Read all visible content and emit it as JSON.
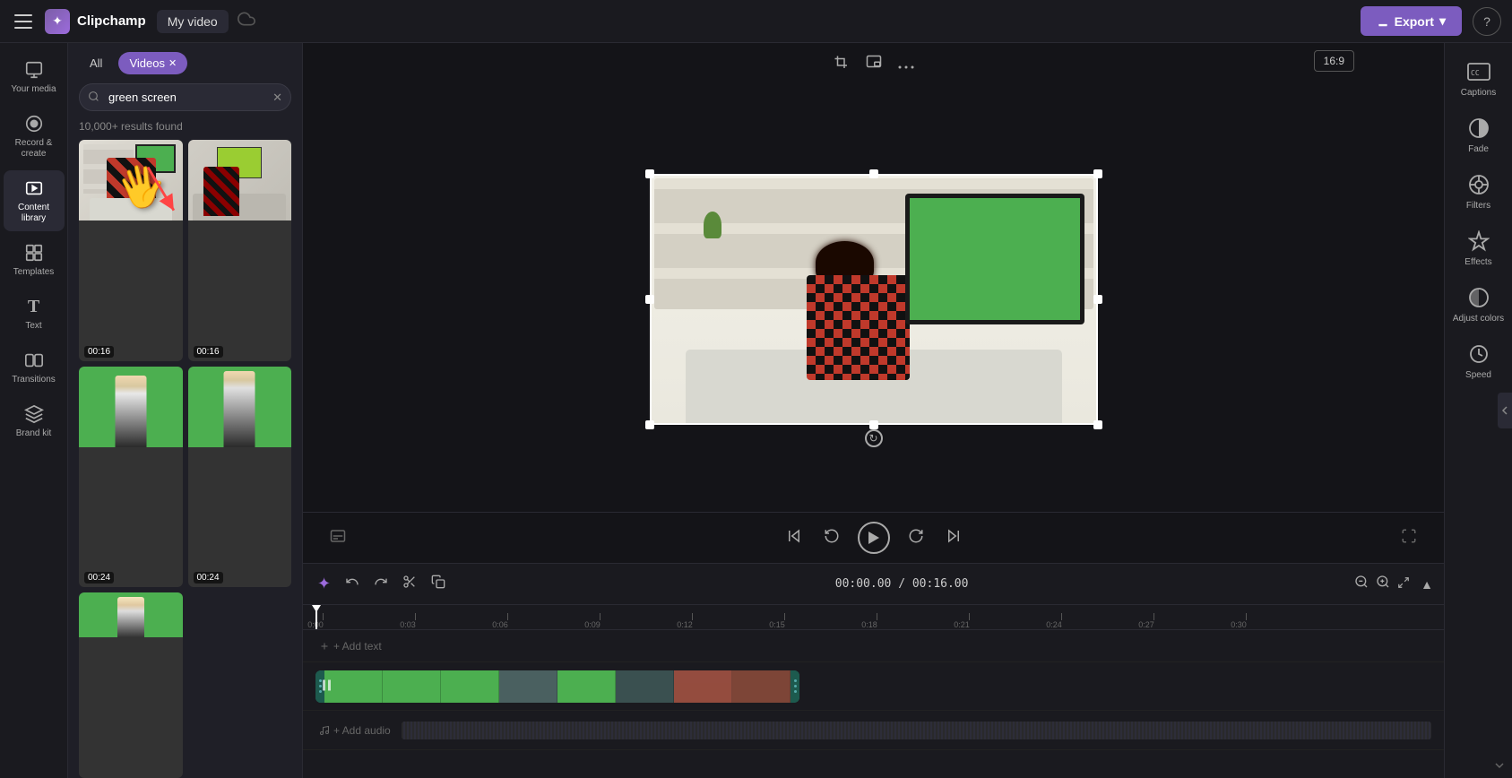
{
  "topbar": {
    "menu_label": "Menu",
    "logo_text": "Clipchamp",
    "logo_icon": "✦",
    "project_name": "My video",
    "cloud_icon": "☁",
    "export_label": "Export",
    "help_icon": "?"
  },
  "sidebar": {
    "items": [
      {
        "id": "your-media",
        "label": "Your media",
        "icon": "🖼"
      },
      {
        "id": "record-create",
        "label": "Record &\ncreate",
        "icon": "⏺"
      },
      {
        "id": "content-library",
        "label": "Content library",
        "icon": "📚"
      },
      {
        "id": "templates",
        "label": "Templates",
        "icon": "⊞"
      },
      {
        "id": "text",
        "label": "Text",
        "icon": "T"
      },
      {
        "id": "transitions",
        "label": "Transitions",
        "icon": "⧉"
      },
      {
        "id": "brand-kit",
        "label": "Brand kit",
        "icon": "◈"
      }
    ]
  },
  "panel": {
    "tabs": [
      {
        "id": "all",
        "label": "All",
        "active": false
      },
      {
        "id": "videos",
        "label": "Videos",
        "active": true
      }
    ],
    "search": {
      "value": "green screen",
      "placeholder": "Search"
    },
    "results_text": "10,000+ results found",
    "thumbnails": [
      {
        "id": 1,
        "duration": "00:16",
        "type": "room-tv"
      },
      {
        "id": 2,
        "duration": "00:16",
        "type": "room-laptop"
      },
      {
        "id": 3,
        "duration": "00:24",
        "type": "person-green"
      },
      {
        "id": 4,
        "duration": "00:24",
        "type": "person-green2"
      }
    ]
  },
  "video_toolbar": {
    "crop_icon": "⛶",
    "pip_icon": "⧉",
    "more_icon": "•••",
    "ratio_label": "16:9",
    "captions_label": "Captions"
  },
  "right_panel": {
    "items": [
      {
        "id": "captions",
        "label": "Captions",
        "icon": "CC"
      },
      {
        "id": "fade",
        "label": "Fade",
        "icon": "◑"
      },
      {
        "id": "filters",
        "label": "Filters",
        "icon": "⊙"
      },
      {
        "id": "effects",
        "label": "Effects",
        "icon": "✦"
      },
      {
        "id": "adjust-colors",
        "label": "Adjust colors",
        "icon": "◑"
      },
      {
        "id": "speed",
        "label": "Speed",
        "icon": "⏱"
      }
    ]
  },
  "playback": {
    "time_current": "00:00.00",
    "time_total": "00:16.00",
    "subtitle_icon": "⊡",
    "rewind_icon": "⏮",
    "back5_icon": "↺",
    "play_icon": "▶",
    "fwd5_icon": "↻",
    "skip_icon": "⏭",
    "fullscreen_icon": "⛶"
  },
  "timeline": {
    "toolbar": {
      "magic_icon": "✦",
      "undo_icon": "↩",
      "redo_icon": "↪",
      "cut_icon": "✂",
      "copy_icon": "⊡",
      "time_display": "00:00.00 / 00:16.00",
      "zoom_out_icon": "−",
      "zoom_in_icon": "+",
      "expand_icon": "⛶"
    },
    "markers": [
      "0:00",
      "0:03",
      "0:06",
      "0:09",
      "0:12",
      "0:15",
      "0:18",
      "0:21",
      "0:24",
      "0:27",
      "0:30"
    ],
    "add_text_label": "+ Add text",
    "add_audio_label": "+ Add audio",
    "clip_duration": "00:16"
  }
}
